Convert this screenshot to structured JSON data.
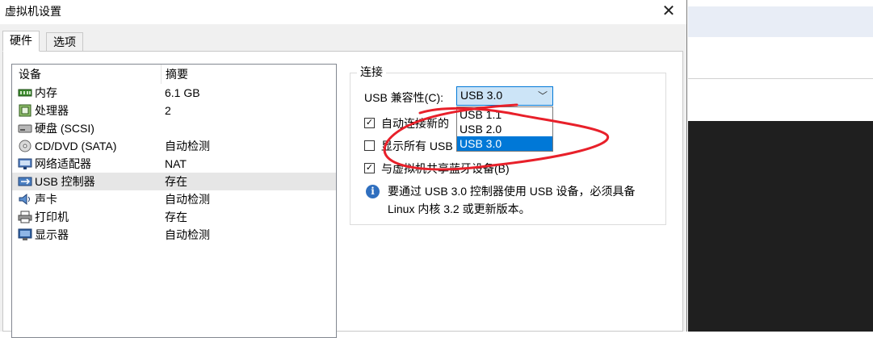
{
  "dialog": {
    "title": "虚拟机设置",
    "close_symbol": "✕"
  },
  "tabs": [
    {
      "label": "硬件",
      "active": true
    },
    {
      "label": "选项",
      "active": false
    }
  ],
  "device_list": {
    "headers": {
      "device": "设备",
      "summary": "摘要"
    },
    "rows": [
      {
        "name": "内存",
        "summary": "6.1 GB",
        "icon": "memory-icon",
        "selected": false
      },
      {
        "name": "处理器",
        "summary": "2",
        "icon": "processor-icon",
        "selected": false
      },
      {
        "name": "硬盘 (SCSI)",
        "summary": "",
        "icon": "hard-disk-icon",
        "selected": false
      },
      {
        "name": "CD/DVD (SATA)",
        "summary": "自动检测",
        "icon": "cd-dvd-icon",
        "selected": false
      },
      {
        "name": "网络适配器",
        "summary": "NAT",
        "icon": "network-adapter-icon",
        "selected": false
      },
      {
        "name": "USB 控制器",
        "summary": "存在",
        "icon": "usb-icon",
        "selected": true
      },
      {
        "name": "声卡",
        "summary": "自动检测",
        "icon": "sound-card-icon",
        "selected": false
      },
      {
        "name": "打印机",
        "summary": "存在",
        "icon": "printer-icon",
        "selected": false
      },
      {
        "name": "显示器",
        "summary": "自动检测",
        "icon": "monitor-icon",
        "selected": false
      }
    ]
  },
  "connection": {
    "group_title": "连接",
    "compat_label": "USB 兼容性(C):",
    "compat_value": "USB 3.0",
    "dropdown_arrow": "﹀",
    "options": [
      "USB 1.1",
      "USB 2.0",
      "USB 3.0"
    ],
    "selected_option": "USB 3.0",
    "checkboxes": [
      {
        "label": "自动连接新的",
        "checked": true
      },
      {
        "label": "显示所有 USB",
        "checked": false
      },
      {
        "label": "与虚拟机共享蓝牙设备(B)",
        "checked": true
      }
    ],
    "info_text": "要通过 USB 3.0 控制器使用 USB 设备，必须具备 Linux 内核 3.2 或更新版本。"
  },
  "colors": {
    "selection_blue": "#0078d7",
    "select_highlight": "#cce4f7",
    "annotation_red": "#e8202a"
  }
}
